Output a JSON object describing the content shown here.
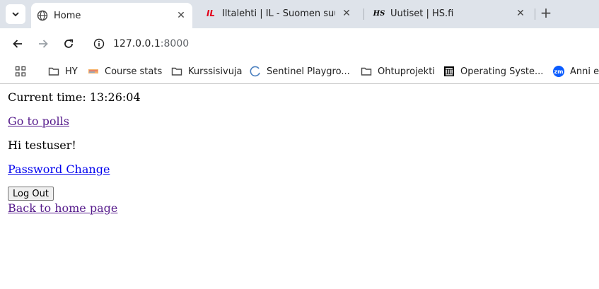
{
  "tabs": [
    {
      "title": "Home",
      "favicon": "globe-icon",
      "active": true
    },
    {
      "title": "Iltalehti | IL - Suomen suurin",
      "favicon": "iltalehti-logo-icon",
      "active": false
    },
    {
      "title": "Uutiset | HS.fi",
      "favicon": "hs-logo-icon",
      "active": false
    }
  ],
  "favicon_text": {
    "iltalehti": "IL",
    "hs": "HS"
  },
  "address_bar": {
    "host": "127.0.0.1",
    "port": ":8000"
  },
  "bookmarks": [
    {
      "label": "HY",
      "icon": "folder-icon"
    },
    {
      "label": "Course stats",
      "icon": "course-stats-icon"
    },
    {
      "label": "Kurssisivuja",
      "icon": "folder-icon"
    },
    {
      "label": "Sentinel Playgro...",
      "icon": "loading-spinner-icon"
    },
    {
      "label": "Ohtuprojekti",
      "icon": "folder-icon"
    },
    {
      "label": "Operating Syste...",
      "icon": "building-icon"
    },
    {
      "label": "Anni et",
      "icon": "zoom-icon",
      "icon_text": "zm"
    }
  ],
  "page": {
    "current_time": "Current time: 13:26:04",
    "polls_link": "Go to polls",
    "greeting": "Hi testuser!",
    "password_change_link": "Password Change",
    "logout_button": "Log Out",
    "home_link": "Back to home page"
  },
  "colors": {
    "tabstrip_bg": "#dee3ea",
    "visited_link": "#551a8b",
    "unvisited_link": "#0000ee",
    "iltalehti_red": "#e2001a",
    "zoom_blue": "#0b5cff"
  }
}
